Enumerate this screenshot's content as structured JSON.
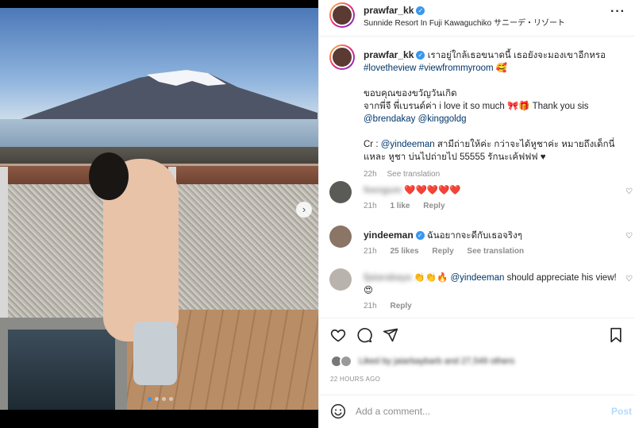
{
  "post": {
    "username": "prawfar_kk",
    "location": "Sunnide Resort In Fuji Kawaguchiko サニーデ・リゾート",
    "more_icon": "more-horizontal-icon"
  },
  "caption": {
    "username": "prawfar_kk",
    "line1": "เราอยู่ใกล้เธอขนาดนี้ เธอยังจะมองเขาอีกหรอ",
    "hashtags": "#lovetheview #viewfrommyroom",
    "emoji1": "🥰",
    "line2": "ขอบคุณของขวัญวันเกิด",
    "line3": "จากพี่จี พี่เบรนด์ค่า i love it so much 🎀🎁 Thank you sis",
    "mentions": "@brendakay @kinggoldg",
    "credit_prefix": "Cr :",
    "credit_mention": "@yindeeman",
    "credit_text": "สามีถ่ายให้ค่ะ กว่าจะได้หูชาค่ะ หมายถึงเด็กนี่แหละ หูชา บ่นไปถ่ายไป 55555 รักนะเค้ฟฟฟ ♥",
    "time": "22h",
    "see_translation": "See translation"
  },
  "comments": [
    {
      "username": "feengum",
      "text": "❤️❤️❤️❤️❤️",
      "time": "21h",
      "likes": "1 like",
      "reply": "Reply"
    },
    {
      "username": "yindeeman",
      "text": "ฉันอยากจะดีกับเธอจริงๆ",
      "time": "21h",
      "likes": "25 likes",
      "reply": "Reply",
      "see_translation": "See translation"
    },
    {
      "username": "fjaiarabaya",
      "emoji": "👏👏🔥",
      "mention": "@yindeeman",
      "text": "should appreciate his view!",
      "emoji2": "😍",
      "time": "21h",
      "reply": "Reply"
    }
  ],
  "likes": {
    "text": "Liked by jaiarbaybarb and 27,549 others"
  },
  "post_time": "22 HOURS AGO",
  "add_comment": {
    "placeholder": "Add a comment...",
    "post_label": "Post"
  }
}
